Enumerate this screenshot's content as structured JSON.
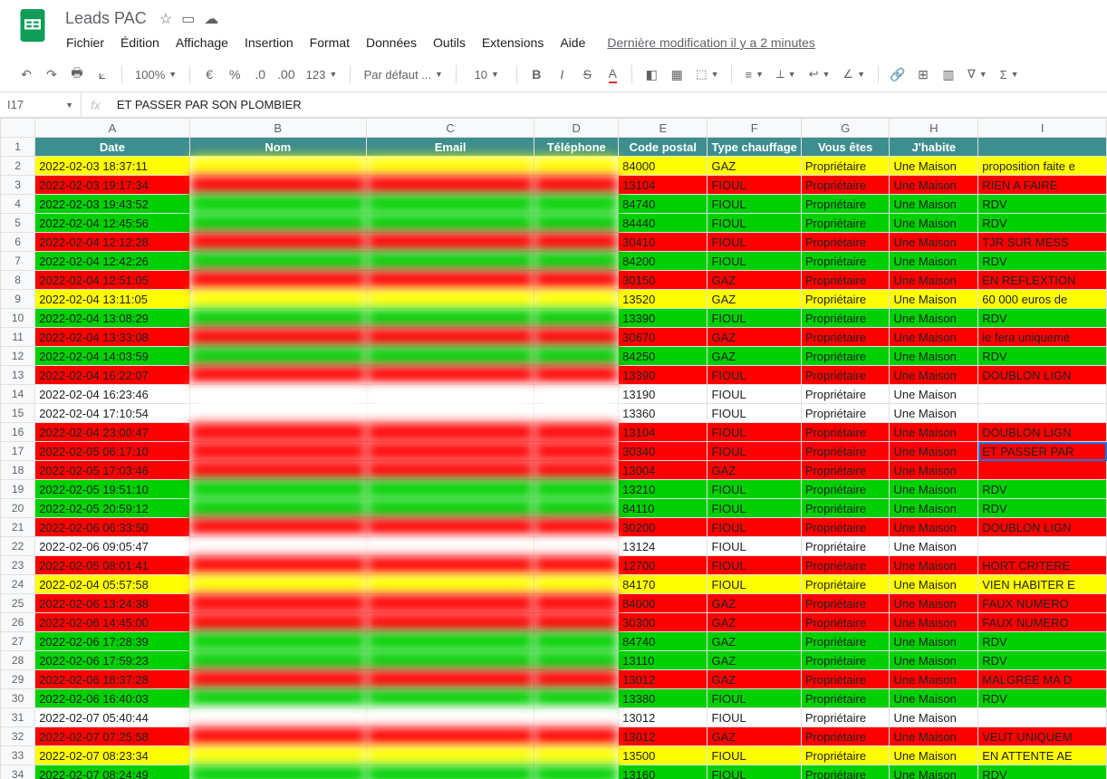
{
  "doc": {
    "title": "Leads PAC"
  },
  "menu": {
    "file": "Fichier",
    "edit": "Édition",
    "view": "Affichage",
    "insert": "Insertion",
    "format": "Format",
    "data": "Données",
    "tools": "Outils",
    "extensions": "Extensions",
    "help": "Aide",
    "last_edit": "Dernière modification il y a 2 minutes"
  },
  "toolbar": {
    "zoom": "100%",
    "font": "Par défaut ...",
    "size": "10"
  },
  "formula": {
    "cell": "I17",
    "value": "ET PASSER PAR SON PLOMBIER"
  },
  "columns": [
    "A",
    "B",
    "C",
    "D",
    "E",
    "F",
    "G",
    "H",
    "I"
  ],
  "headers": {
    "date": "Date",
    "nom": "Nom",
    "email": "Email",
    "tel": "Téléphone",
    "cp": "Code postal",
    "chauffage": "Type chauffage",
    "vous": "Vous êtes",
    "habite": "J'habite"
  },
  "rows": [
    {
      "n": 2,
      "color": "yellow",
      "date": "2022-02-03 18:37:11",
      "cp": "84000",
      "ch": "GAZ",
      "vous": "Propriétaire",
      "hab": "Une Maison",
      "note": "proposition faite e"
    },
    {
      "n": 3,
      "color": "red",
      "date": "2022-02-03 19:17:34",
      "cp": "13104",
      "ch": "FIOUL",
      "vous": "Propriétaire",
      "hab": "Une Maison",
      "note": "RIEN A FAIRE"
    },
    {
      "n": 4,
      "color": "green",
      "date": "2022-02-03 19:43:52",
      "cp": "84740",
      "ch": "FIOUL",
      "vous": "Propriétaire",
      "hab": "Une Maison",
      "note": "RDV"
    },
    {
      "n": 5,
      "color": "green",
      "date": "2022-02-04 12:45:56",
      "cp": "84440",
      "ch": "FIOUL",
      "vous": "Propriétaire",
      "hab": "Une Maison",
      "note": "RDV"
    },
    {
      "n": 6,
      "color": "red",
      "date": "2022-02-04 12:12:28",
      "cp": "30410",
      "ch": "FIOUL",
      "vous": "Propriétaire",
      "hab": "Une Maison",
      "note": "TJR SUR MESS"
    },
    {
      "n": 7,
      "color": "green",
      "date": "2022-02-04 12:42:26",
      "cp": "84200",
      "ch": "FIOUL",
      "vous": "Propriétaire",
      "hab": "Une Maison",
      "note": "RDV"
    },
    {
      "n": 8,
      "color": "red",
      "date": "2022-02-04 12:51:05",
      "cp": "30150",
      "ch": "GAZ",
      "vous": "Propriétaire",
      "hab": "Une Maison",
      "note": "EN REFLEXTION"
    },
    {
      "n": 9,
      "color": "yellow",
      "date": "2022-02-04 13:11:05",
      "cp": "13520",
      "ch": "GAZ",
      "vous": "Propriétaire",
      "hab": "Une Maison",
      "note": "60 000 euros de"
    },
    {
      "n": 10,
      "color": "green",
      "date": "2022-02-04 13:08:29",
      "cp": "13390",
      "ch": "FIOUL",
      "vous": "Propriétaire",
      "hab": "Une Maison",
      "note": "RDV"
    },
    {
      "n": 11,
      "color": "red",
      "date": "2022-02-04 13:33:08",
      "cp": "30670",
      "ch": "GAZ",
      "vous": "Propriétaire",
      "hab": "Une Maison",
      "note": "le fera uniqueme"
    },
    {
      "n": 12,
      "color": "green",
      "date": "2022-02-04 14:03:59",
      "cp": "84250",
      "ch": "GAZ",
      "vous": "Propriétaire",
      "hab": "Une Maison",
      "note": "RDV"
    },
    {
      "n": 13,
      "color": "red",
      "date": "2022-02-04 16:22:07",
      "cp": "13390",
      "ch": "FIOUL",
      "vous": "Propriétaire",
      "hab": "Une Maison",
      "note": "DOUBLON LIGN"
    },
    {
      "n": 14,
      "color": "white",
      "date": "2022-02-04 16:23:46",
      "cp": "13190",
      "ch": "FIOUL",
      "vous": "Propriétaire",
      "hab": "Une Maison",
      "note": ""
    },
    {
      "n": 15,
      "color": "white",
      "date": "2022-02-04 17:10:54",
      "cp": "13360",
      "ch": "FIOUL",
      "vous": "Propriétaire",
      "hab": "Une Maison",
      "note": ""
    },
    {
      "n": 16,
      "color": "red",
      "date": "2022-02-04 23:00:47",
      "cp": "13104",
      "ch": "FIOUL",
      "vous": "Propriétaire",
      "hab": "Une Maison",
      "note": "DOUBLON LIGN"
    },
    {
      "n": 17,
      "color": "red",
      "date": "2022-02-05 06:17:10",
      "cp": "30340",
      "ch": "FIOUL",
      "vous": "Propriétaire",
      "hab": "Une Maison",
      "note": "ET PASSER PAR",
      "sel": true
    },
    {
      "n": 18,
      "color": "red",
      "date": "2022-02-05 17:03:46",
      "cp": "13004",
      "ch": "GAZ",
      "vous": "Propriétaire",
      "hab": "Une Maison",
      "note": ""
    },
    {
      "n": 19,
      "color": "green",
      "date": "2022-02-05 19:51:10",
      "cp": "13210",
      "ch": "FIOUL",
      "vous": "Propriétaire",
      "hab": "Une Maison",
      "note": "RDV"
    },
    {
      "n": 20,
      "color": "green",
      "date": "2022-02-05 20:59:12",
      "cp": "84110",
      "ch": "FIOUL",
      "vous": "Propriétaire",
      "hab": "Une Maison",
      "note": "RDV"
    },
    {
      "n": 21,
      "color": "red",
      "date": "2022-02-06 06:33:50",
      "cp": "30200",
      "ch": "FIOUL",
      "vous": "Propriétaire",
      "hab": "Une Maison",
      "note": "DOUBLON  LIGN"
    },
    {
      "n": 22,
      "color": "white",
      "date": "2022-02-06 09:05:47",
      "cp": "13124",
      "ch": "FIOUL",
      "vous": "Propriétaire",
      "hab": "Une Maison",
      "note": ""
    },
    {
      "n": 23,
      "color": "red",
      "date": "2022-02-05 08:01:41",
      "cp": "12700",
      "ch": "FIOUL",
      "vous": "Propriétaire",
      "hab": "Une Maison",
      "note": "HORT CRITERE"
    },
    {
      "n": 24,
      "color": "yellow",
      "date": "2022-02-04 05:57:58",
      "cp": "84170",
      "ch": "FIOUL",
      "vous": "Propriétaire",
      "hab": "Une Maison",
      "note": "VIEN HABITER E"
    },
    {
      "n": 25,
      "color": "red",
      "date": "2022-02-06 13:24:38",
      "cp": "84000",
      "ch": "GAZ",
      "vous": "Propriétaire",
      "hab": "Une Maison",
      "note": "FAUX NUMERO"
    },
    {
      "n": 26,
      "color": "red",
      "date": "2022-02-06 14:45:00",
      "cp": "30300",
      "ch": "GAZ",
      "vous": "Propriétaire",
      "hab": "Une Maison",
      "note": "FAUX NUMERO"
    },
    {
      "n": 27,
      "color": "green",
      "date": "2022-02-06 17:28:39",
      "cp": "84740",
      "ch": "GAZ",
      "vous": "Propriétaire",
      "hab": "Une Maison",
      "note": "RDV"
    },
    {
      "n": 28,
      "color": "green",
      "date": "2022-02-06 17:59:23",
      "cp": "13110",
      "ch": "GAZ",
      "vous": "Propriétaire",
      "hab": "Une Maison",
      "note": "RDV"
    },
    {
      "n": 29,
      "color": "red",
      "date": "2022-02-06 18:37:28",
      "cp": "13012",
      "ch": "GAZ",
      "vous": "Propriétaire",
      "hab": "Une Maison",
      "note": "MALGREE MA D"
    },
    {
      "n": 30,
      "color": "green",
      "date": "2022-02-06 16:40:03",
      "cp": "13380",
      "ch": "FIOUL",
      "vous": "Propriétaire",
      "hab": "Une Maison",
      "note": "RDV"
    },
    {
      "n": 31,
      "color": "white",
      "date": "2022-02-07 05:40:44",
      "cp": "13012",
      "ch": "FIOUL",
      "vous": "Propriétaire",
      "hab": "Une Maison",
      "note": ""
    },
    {
      "n": 32,
      "color": "red",
      "date": "2022-02-07 07:25:58",
      "cp": "13012",
      "ch": "GAZ",
      "vous": "Propriétaire",
      "hab": "Une Maison",
      "note": "VEUT UNIQUEM"
    },
    {
      "n": 33,
      "color": "yellow",
      "date": "2022-02-07 08:23:34",
      "cp": "13500",
      "ch": "FIOUL",
      "vous": "Propriétaire",
      "hab": "Une Maison",
      "note": "EN ATTENTE AE"
    },
    {
      "n": 34,
      "color": "green",
      "date": "2022-02-07 08:24:49",
      "cp": "13160",
      "ch": "FIOUL",
      "vous": "Propriétaire",
      "hab": "Une Maison",
      "note": "RDV"
    }
  ]
}
